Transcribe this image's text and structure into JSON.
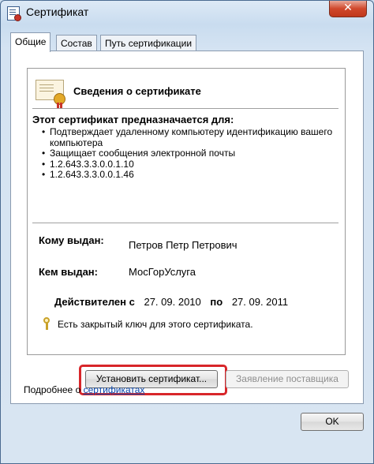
{
  "window": {
    "title": "Сертификат",
    "close_glyph": "✕"
  },
  "tabs": [
    {
      "label": "Общие",
      "active": true
    },
    {
      "label": "Состав",
      "active": false
    },
    {
      "label": "Путь сертификации",
      "active": false
    }
  ],
  "info": {
    "title": "Сведения о сертификате",
    "purpose_title": "Этот сертификат предназначается для:",
    "purposes": [
      "Подтверждает удаленному компьютеру идентификацию вашего компьютера",
      "Защищает сообщения электронной почты",
      "1.2.643.3.3.0.0.1.10",
      "1.2.643.3.3.0.0.1.46"
    ],
    "issued_to_label": "Кому выдан:",
    "issued_to_value": "Петров Петр Петрович",
    "issued_by_label": "Кем выдан:",
    "issued_by_value": "МосГорУслуга",
    "valid_from_label": "Действителен с",
    "valid_from": "27. 09. 2010",
    "valid_to_label": "по",
    "valid_to": "27. 09. 2011",
    "private_key_text": "Есть закрытый ключ для этого сертификата."
  },
  "actions": {
    "install_label": "Установить сертификат...",
    "issuer_statement_label": "Заявление поставщика"
  },
  "more_info": {
    "prefix": "Подробнее о",
    "link": "сертификатах"
  },
  "footer": {
    "ok_label": "OK"
  },
  "colors": {
    "highlight": "#d8262a",
    "link": "#0645ad",
    "close_button": "#d0482c"
  },
  "icons": [
    "certificate-icon",
    "close-icon",
    "key-icon"
  ]
}
